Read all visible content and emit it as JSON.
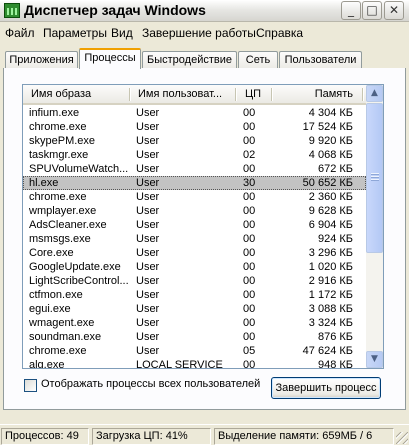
{
  "window": {
    "title": "Диспетчер задач Windows",
    "buttons": {
      "minimize": "_",
      "maximize": "□",
      "close": "✕"
    }
  },
  "menu": [
    "Файл",
    "Параметры",
    "Вид",
    "Завершение работы",
    "Справка"
  ],
  "tabs": [
    {
      "label": "Приложения",
      "active": false
    },
    {
      "label": "Процессы",
      "active": true
    },
    {
      "label": "Быстродействие",
      "active": false
    },
    {
      "label": "Сеть",
      "active": false
    },
    {
      "label": "Пользователи",
      "active": false
    }
  ],
  "table": {
    "columns": [
      "Имя образа",
      "Имя пользоват...",
      "ЦП",
      "Память"
    ],
    "rows": [
      {
        "name": "infium.exe",
        "user": "User",
        "cpu": "00",
        "mem": "4 304 КБ"
      },
      {
        "name": "chrome.exe",
        "user": "User",
        "cpu": "00",
        "mem": "17 524 КБ"
      },
      {
        "name": "skypePM.exe",
        "user": "User",
        "cpu": "00",
        "mem": "9 920 КБ"
      },
      {
        "name": "taskmgr.exe",
        "user": "User",
        "cpu": "02",
        "mem": "4 068 КБ"
      },
      {
        "name": "SPUVolumeWatch...",
        "user": "User",
        "cpu": "00",
        "mem": "672 КБ"
      },
      {
        "name": "hl.exe",
        "user": "User",
        "cpu": "30",
        "mem": "50 652 КБ",
        "selected": true
      },
      {
        "name": "chrome.exe",
        "user": "User",
        "cpu": "00",
        "mem": "2 360 КБ"
      },
      {
        "name": "wmplayer.exe",
        "user": "User",
        "cpu": "00",
        "mem": "9 628 КБ"
      },
      {
        "name": "AdsCleaner.exe",
        "user": "User",
        "cpu": "00",
        "mem": "6 904 КБ"
      },
      {
        "name": "msmsgs.exe",
        "user": "User",
        "cpu": "00",
        "mem": "924 КБ"
      },
      {
        "name": "Core.exe",
        "user": "User",
        "cpu": "00",
        "mem": "3 296 КБ"
      },
      {
        "name": "GoogleUpdate.exe",
        "user": "User",
        "cpu": "00",
        "mem": "1 020 КБ"
      },
      {
        "name": "LightScribeControl...",
        "user": "User",
        "cpu": "00",
        "mem": "2 916 КБ"
      },
      {
        "name": "ctfmon.exe",
        "user": "User",
        "cpu": "00",
        "mem": "1 172 КБ"
      },
      {
        "name": "egui.exe",
        "user": "User",
        "cpu": "00",
        "mem": "3 088 КБ"
      },
      {
        "name": "wmagent.exe",
        "user": "User",
        "cpu": "00",
        "mem": "3 324 КБ"
      },
      {
        "name": "soundman.exe",
        "user": "User",
        "cpu": "00",
        "mem": "876 КБ"
      },
      {
        "name": "chrome.exe",
        "user": "User",
        "cpu": "05",
        "mem": "47 624 КБ"
      },
      {
        "name": "alg.exe",
        "user": "LOCAL SERVICE",
        "cpu": "00",
        "mem": "948 КБ"
      }
    ]
  },
  "scrollbar": {
    "up_icon": "▲",
    "down_icon": "▼"
  },
  "show_all_users": {
    "label": "Отображать процессы всех пользователей",
    "checked": false
  },
  "end_process_button": "Завершить процесс",
  "status": {
    "processes": "Процессов: 49",
    "cpu": "Загрузка ЦП: 41%",
    "memory": "Выделение памяти: 659МБ / 6"
  },
  "colors": {
    "window_bg": "#ece9d8",
    "selected_row": "#c3c3c3",
    "active_tab_accent": "#f0a000",
    "list_border": "#7f9db9"
  }
}
